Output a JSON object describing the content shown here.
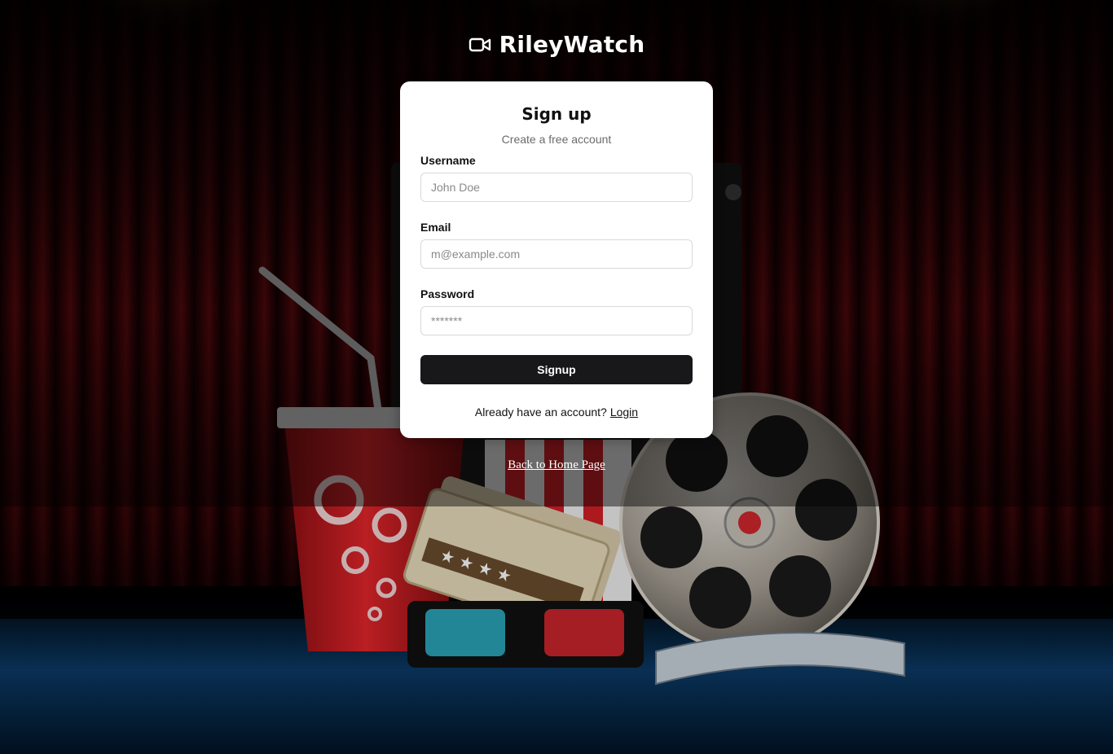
{
  "brand": {
    "name": "RileyWatch",
    "icon": "video-camera-icon"
  },
  "signup_card": {
    "title": "Sign up",
    "subtitle": "Create a free account",
    "fields": {
      "username": {
        "label": "Username",
        "placeholder": "John Doe",
        "value": ""
      },
      "email": {
        "label": "Email",
        "placeholder": "m@example.com",
        "value": ""
      },
      "password": {
        "label": "Password",
        "placeholder": "*******",
        "value": ""
      }
    },
    "submit_label": "Signup",
    "login_prompt": "Already have an account?",
    "login_link": "Login"
  },
  "back_link": "Back to Home Page",
  "colors": {
    "button_bg": "#18181b",
    "curtain_red": "#b3121a",
    "floor_blue": "#0b3a66"
  }
}
